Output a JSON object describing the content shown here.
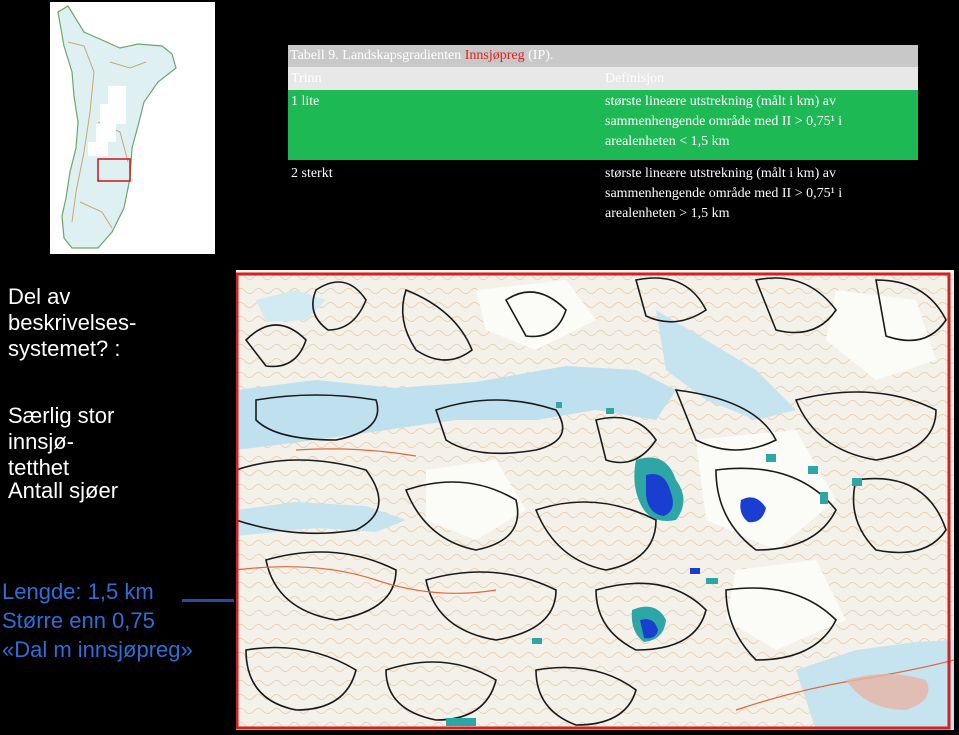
{
  "table": {
    "caption_prefix": "Tabell 9. Landskapsgradienten ",
    "caption_highlight": "Innsjøpreg",
    "caption_suffix": " (IP).",
    "col_step": "Trinn",
    "col_definition": "Definisjon",
    "rows": [
      {
        "step": "1 lite",
        "line1": "største lineære utstrekning (målt i km) av",
        "line2": "sammenhengende område med II > 0,75¹ i",
        "line3": "arealenheten < 1,5 km"
      },
      {
        "step": "2 sterkt",
        "line1": "største lineære utstrekning (målt i km) av",
        "line2": "sammenhengende område med II > 0,75¹ i",
        "line3": "arealenheten > 1,5 km"
      }
    ]
  },
  "sidebar": {
    "question": [
      "Del av",
      "beskrivelses-",
      "systemet? :"
    ],
    "features": [
      "Særlig stor",
      "innsjø-",
      "tetthet",
      "Antall sjøer"
    ],
    "criteria": [
      "Lengde: 1,5 km",
      "Større enn 0,75",
      "«Dal m innsjøpreg»"
    ]
  },
  "colors": {
    "highlight_row": "#1db954",
    "caption_highlight": "#e0201c",
    "criteria_text": "#2f6ed6",
    "map_frame": "#d42020",
    "lake_fill": "#1a3fd0"
  },
  "icons": [
    "overview-map-image",
    "topographic-map-image"
  ]
}
